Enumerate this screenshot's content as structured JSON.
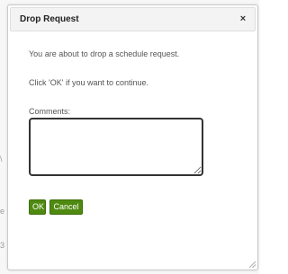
{
  "dialog": {
    "title": "Drop Request",
    "close_glyph": "×",
    "message_line_1": "You are about to drop a schedule request.",
    "message_line_2": "Click 'OK' if you want to continue.",
    "comments_label": "Comments:",
    "comments_value": "",
    "ok_label": "OK",
    "cancel_label": "Cancel"
  },
  "background": {
    "fragments": [
      "\\",
      "e",
      "3"
    ]
  },
  "colors": {
    "button_green": "#4f8a10",
    "title_bar": "#f3f3f3",
    "text": "#555555"
  }
}
